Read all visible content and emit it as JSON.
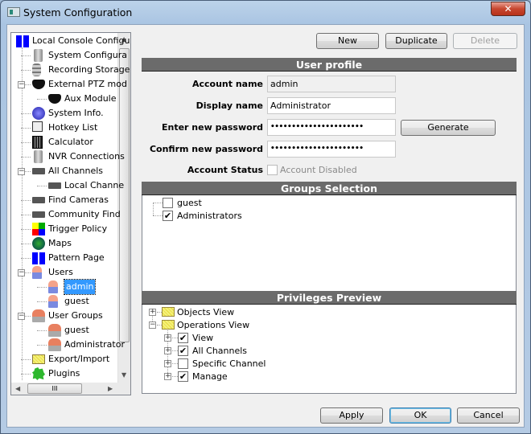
{
  "window": {
    "title": "System Configuration",
    "close_glyph": "✕"
  },
  "tree": {
    "items": [
      {
        "label": "Local Console Configu",
        "icon": "grid-icon",
        "level": 0
      },
      {
        "label": "System Configura",
        "icon": "server-icon",
        "level": 1
      },
      {
        "label": "Recording Storage",
        "icon": "database-icon",
        "level": 1
      },
      {
        "label": "External PTZ mod",
        "icon": "dome-camera-icon",
        "level": 1,
        "expanded": true
      },
      {
        "label": "Aux Module",
        "icon": "dome-camera-icon",
        "level": 2
      },
      {
        "label": "System Info.",
        "icon": "info-icon",
        "level": 1
      },
      {
        "label": "Hotkey List",
        "icon": "key-icon",
        "level": 1
      },
      {
        "label": "Calculator",
        "icon": "calculator-icon",
        "level": 1
      },
      {
        "label": "NVR Connections",
        "icon": "server-icon",
        "level": 1
      },
      {
        "label": "All Channels",
        "icon": "camera-icon",
        "level": 1,
        "expanded": true
      },
      {
        "label": "Local Channe",
        "icon": "camera-icon",
        "level": 2
      },
      {
        "label": "Find Cameras",
        "icon": "camera-icon",
        "level": 1
      },
      {
        "label": "Community Find",
        "icon": "camera-icon",
        "level": 1
      },
      {
        "label": "Trigger Policy",
        "icon": "trigger-icon",
        "level": 1
      },
      {
        "label": "Maps",
        "icon": "globe-icon",
        "level": 1
      },
      {
        "label": "Pattern Page",
        "icon": "grid-icon",
        "level": 1
      },
      {
        "label": "Users",
        "icon": "user-icon",
        "level": 1,
        "expanded": true
      },
      {
        "label": "admin",
        "icon": "user-icon",
        "level": 2,
        "selected": true
      },
      {
        "label": "guest",
        "icon": "user-icon",
        "level": 2
      },
      {
        "label": "User Groups",
        "icon": "group-icon",
        "level": 1,
        "expanded": true
      },
      {
        "label": "guest",
        "icon": "group-icon",
        "level": 2
      },
      {
        "label": "Administrator",
        "icon": "group-icon",
        "level": 2
      },
      {
        "label": "Export/Import",
        "icon": "folder-icon",
        "level": 1
      },
      {
        "label": "Plugins",
        "icon": "puzzle-icon",
        "level": 1
      }
    ],
    "hscroll_glyph": "III"
  },
  "toolbar": {
    "new": "New",
    "duplicate": "Duplicate",
    "delete": "Delete"
  },
  "profile": {
    "header": "User profile",
    "account_name_label": "Account name",
    "account_name": "admin",
    "display_name_label": "Display name",
    "display_name": "Administrator",
    "password_label": "Enter new password",
    "password": "••••••••••••••••••••••",
    "confirm_label": "Confirm new password",
    "confirm": "••••••••••••••••••••••",
    "generate": "Generate",
    "status_label": "Account Status",
    "disabled_label": "Account Disabled",
    "disabled": false
  },
  "groups": {
    "header": "Groups Selection",
    "items": [
      {
        "label": "guest",
        "checked": false
      },
      {
        "label": "Administrators",
        "checked": true
      }
    ]
  },
  "privileges": {
    "header": "Privileges Preview",
    "objects_view": "Objects View",
    "operations_view": "Operations View",
    "items": [
      {
        "label": "View",
        "checked": true
      },
      {
        "label": "All Channels",
        "checked": true
      },
      {
        "label": "Specific Channel",
        "checked": false
      },
      {
        "label": "Manage",
        "checked": true
      }
    ]
  },
  "footer": {
    "apply": "Apply",
    "ok": "OK",
    "cancel": "Cancel"
  },
  "check_glyph": "✔"
}
